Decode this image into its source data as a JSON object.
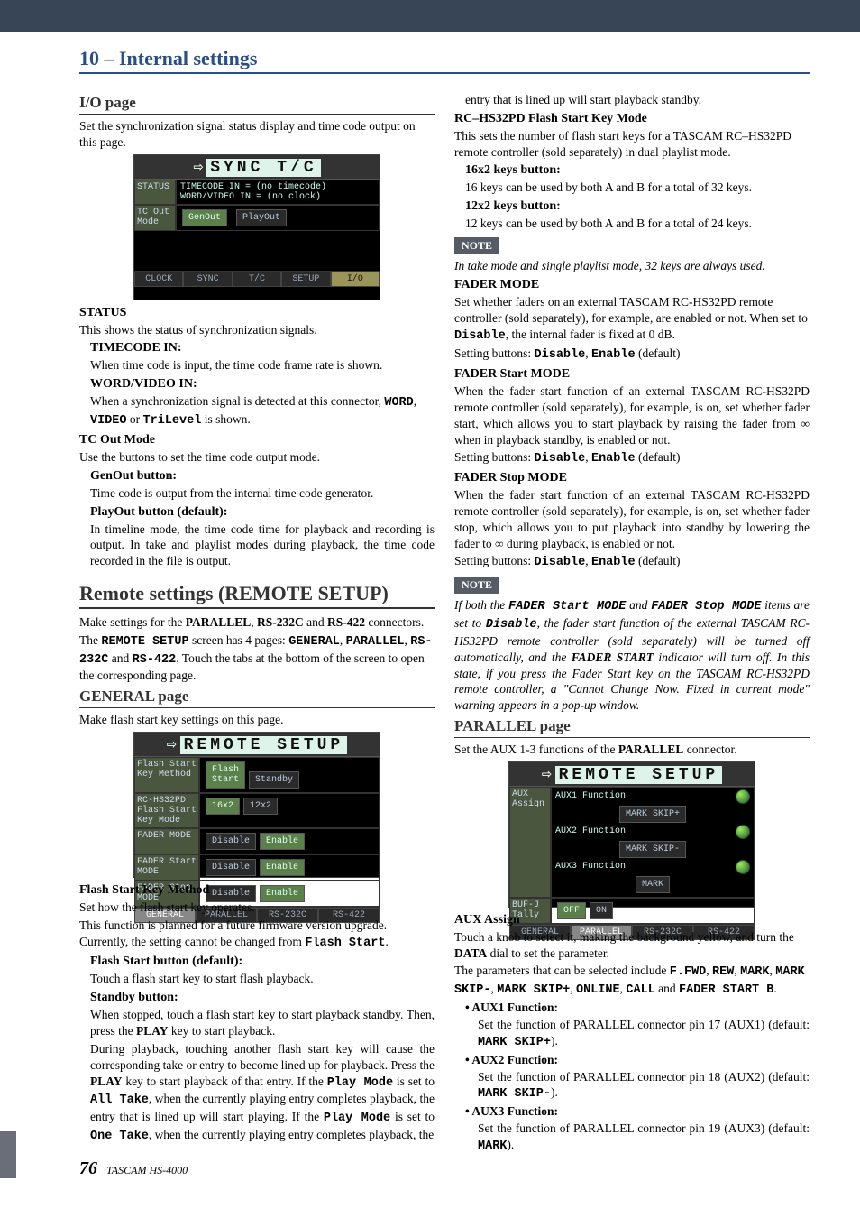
{
  "chapter_title": "10 – Internal settings",
  "footer": {
    "page": "76",
    "model": "TASCAM HS-4000"
  },
  "left": {
    "io_h": "I/O page",
    "io_p": "Set the synchronization signal status display and time code output on this page.",
    "status_h": "STATUS",
    "status_p": "This shows the status of synchronization signals.",
    "tc_in_h": "TIMECODE IN:",
    "tc_in_p": "When time code is input, the time code frame rate is shown.",
    "wv_in_h": "WORD/VIDEO IN:",
    "wv_in_p1": "When a synchronization signal is detected at this connector,",
    "wv_in_words1": "WORD",
    "wv_in_sep1": ", ",
    "wv_in_words2": "VIDEO",
    "wv_in_mid": " or ",
    "wv_in_words3": "TriLevel",
    "wv_in_tail": " is shown.",
    "tc_out_h": "TC Out Mode",
    "tc_out_p": "Use the buttons to set the time code output mode.",
    "genout_h": "GenOut button:",
    "genout_p": "Time code is output from the internal time code generator.",
    "playout_h": "PlayOut button (default):",
    "playout_p": "In timeline mode, the time code time for playback and recording is output. In take and playlist modes during playback, the time code recorded in the file is output.",
    "remote_h": "Remote settings (REMOTE SETUP)",
    "remote_p1a": "Make settings for the ",
    "remote_p1b": "PARALLEL",
    "remote_p1c": ", ",
    "remote_p1d": "RS-232C",
    "remote_p1e": " and ",
    "remote_p1f": "RS-422",
    "remote_p1g": " connectors.",
    "remote_p2a": "The ",
    "remote_p2b": "REMOTE SETUP",
    "remote_p2c": " screen has 4 pages: ",
    "remote_p2d": "GENERAL",
    "remote_p2e": ", ",
    "remote_p2f": "PARALLEL",
    "remote_p2g": ", ",
    "remote_p2h": "RS-232C",
    "remote_p2i": " and ",
    "remote_p2j": "RS-422",
    "remote_p2k": ". Touch the tabs at the bottom of the screen to open the corresponding page.",
    "gen_page_h": "GENERAL page",
    "gen_page_p": "Make flash start key settings on this page.",
    "fs_method_h": "Flash Start Key Method",
    "fs_method_p1": "Set how the flash start key operates.",
    "fs_method_p2a": "This function is planned for a future firmware version upgrade. Currently, the setting cannot be changed from ",
    "fs_method_p2b": "Flash Start",
    "fs_method_p2c": ".",
    "fs_btn_h": "Flash Start button (default):",
    "fs_btn_p": "Touch a flash start key to start flash playback.",
    "stb_btn_h": "Standby button:",
    "stb_p1": "When stopped, touch a flash start key to start playback standby. Then, press the ",
    "stb_p1b": "PLAY",
    "stb_p1c": " key to start playback.",
    "stb_p2a": "During playback, touching another flash start key will cause the corresponding take or entry to become lined up for playback. Press the ",
    "stb_p2b": "PLAY",
    "stb_p2c": " key to start playback of that entry. If the ",
    "stb_p2d": "Play Mode",
    "stb_p2e": " is set to ",
    "stb_p2f": "All Take",
    "stb_p2g": ", when the currently playing entry completes playback, the entry that is lined up will start playing. If the ",
    "stb_p2h": "Play Mode",
    "stb_p2i": " is set to ",
    "stb_p2j": "One Take",
    "stb_p2k": ", when the currently playing entry completes playback, the"
  },
  "right": {
    "cont": "entry that is lined up will start playback standby.",
    "rcfs_h": "RC–HS32PD Flash Start Key Mode",
    "rcfs_p": "This sets the number of flash start keys for a TASCAM RC–HS32PD remote controller (sold separately) in dual playlist mode.",
    "k16_h": "16x2 keys button:",
    "k16_p": "16 keys can be used by both A and B for a total of 32 keys.",
    "k12_h": "12x2 keys button:",
    "k12_p": "12 keys can be used by both A and B for a total of 24 keys.",
    "note1_l": "NOTE",
    "note1_p": "In take mode and single playlist mode, 32 keys are always used.",
    "fader_mode_h": "FADER MODE",
    "fader_mode_p1": "Set whether faders on an external TASCAM RC-HS32PD remote controller (sold separately), for example, are enabled or not. When set to ",
    "fader_mode_p1b": "Disable",
    "fader_mode_p1c": ", the internal fader is fixed at 0 dB.",
    "setbtns_a": "Setting buttons: ",
    "setbtns_b": "Disable",
    "setbtns_c": ", ",
    "setbtns_d": "Enable",
    "setbtns_e": " (default)",
    "fstart_h": "FADER Start MODE",
    "fstart_p": "When the fader start function of an external TASCAM RC-HS32PD remote controller (sold separately), for example, is on, set whether fader start, which allows you to start playback by raising the fader from ∞ when in playback standby, is enabled or not.",
    "fstop_h": "FADER Stop MODE",
    "fstop_p": "When the fader start function of an external TASCAM RC-HS32PD remote controller (sold separately), for example, is on, set whether fader stop, which allows you to put playback into standby by lowering the fader to ∞ during playback, is enabled or not.",
    "note2_l": "NOTE",
    "note2_p_a": "If both the ",
    "note2_p_b": "FADER Start MODE",
    "note2_p_c": " and ",
    "note2_p_d": "FADER Stop MODE",
    "note2_p_e": " items are set to ",
    "note2_p_f": "Disable",
    "note2_p_g": ", the fader start function of the external TASCAM RC-HS32PD remote controller (sold separately) will be turned off automatically, and the ",
    "note2_p_h": "FADER START",
    "note2_p_i": " indicator will turn off. In this state, if you press the Fader Start key on the TASCAM RC-HS32PD remote controller, a \"Cannot Change Now. Fixed in current mode\" warning appears in a pop-up window.",
    "par_h": "PARALLEL page",
    "par_p_a": "Set the AUX 1-3 functions of the ",
    "par_p_b": "PARALLEL",
    "par_p_c": " connector.",
    "aux_assign_h": "AUX Assign",
    "aux_assign_p1": "Touch a knob to select it, making the background yellow, and turn the ",
    "aux_assign_p1b": "DATA",
    "aux_assign_p1c": " dial to set the parameter.",
    "aux_assign_p2a": "The parameters that can be selected include ",
    "aux_assign_p2b": "F.FWD",
    "aux_assign_p2c": ", ",
    "aux_assign_p2d": "REW",
    "aux_assign_p2e": ", ",
    "aux_assign_p2f": "MARK",
    "aux_assign_p2g": ", ",
    "aux_assign_p2h": "MARK SKIP-",
    "aux_assign_p2i": ", ",
    "aux_assign_p2j": "MARK SKIP+",
    "aux_assign_p2k": ", ",
    "aux_assign_p2l": "ONLINE",
    "aux_assign_p2m": ", ",
    "aux_assign_p2n": "CALL",
    "aux_assign_p2o": " and ",
    "aux_assign_p2p": "FADER START B",
    "aux_assign_p2q": ".",
    "aux1_h": "AUX1 Function:",
    "aux1_p_a": "Set the function of PARALLEL connector pin 17 (AUX1) (default: ",
    "aux1_p_b": "MARK SKIP+",
    "aux1_p_c": ").",
    "aux2_h": "AUX2 Function:",
    "aux2_p_a": "Set the function of PARALLEL connector pin 18 (AUX2) (default: ",
    "aux2_p_b": "MARK SKIP-",
    "aux2_p_c": ").",
    "aux3_h": "AUX3 Function:",
    "aux3_p_a": "Set the function of PARALLEL connector pin 19 (AUX3) (default: ",
    "aux3_p_b": "MARK",
    "aux3_p_c": ")."
  },
  "shot1": {
    "title_pre": "",
    "title_hi": "SYNC T/C",
    "status_lbl": "STATUS",
    "tc_line": "TIMECODE   IN = (no timecode)",
    "wv_line": "WORD/VIDEO IN = (no clock)",
    "tcmode_lbl": "TC Out\nMode",
    "genout": "GenOut",
    "playout": "PlayOut",
    "tabs": [
      "CLOCK",
      "SYNC",
      "T/C",
      "SETUP",
      "I/O"
    ]
  },
  "shot2": {
    "title_hi": "REMOTE SETUP",
    "rows": [
      {
        "label": "Flash Start\nKey Method",
        "a": "Flash\nStart",
        "b": "Standby"
      },
      {
        "label": "RC-HS32PD\nFlash Start\nKey Mode",
        "a": "16x2",
        "b": "12x2"
      },
      {
        "label": "FADER MODE",
        "a": "Disable",
        "b": "Enable"
      },
      {
        "label": "FADER Start\nMODE",
        "a": "Disable",
        "b": "Enable"
      },
      {
        "label": "FADER Stop\nMODE",
        "a": "Disable",
        "b": "Enable"
      }
    ],
    "tabs": [
      "GENERAL",
      "PARALLEL",
      "RS-232C",
      "RS-422"
    ]
  },
  "shot3": {
    "title_hi": "REMOTE SETUP",
    "assign_lbl": "AUX\nAssign",
    "rows": [
      {
        "label": "AUX1 Function",
        "val": "MARK SKIP+"
      },
      {
        "label": "AUX2 Function",
        "val": "MARK SKIP-"
      },
      {
        "label": "AUX3 Function",
        "val": "MARK"
      }
    ],
    "bufjt": "BUF-J\nTally",
    "off": "OFF",
    "on": "ON",
    "tabs": [
      "GENERAL",
      "PARALLEL",
      "RS-232C",
      "RS-422"
    ]
  }
}
